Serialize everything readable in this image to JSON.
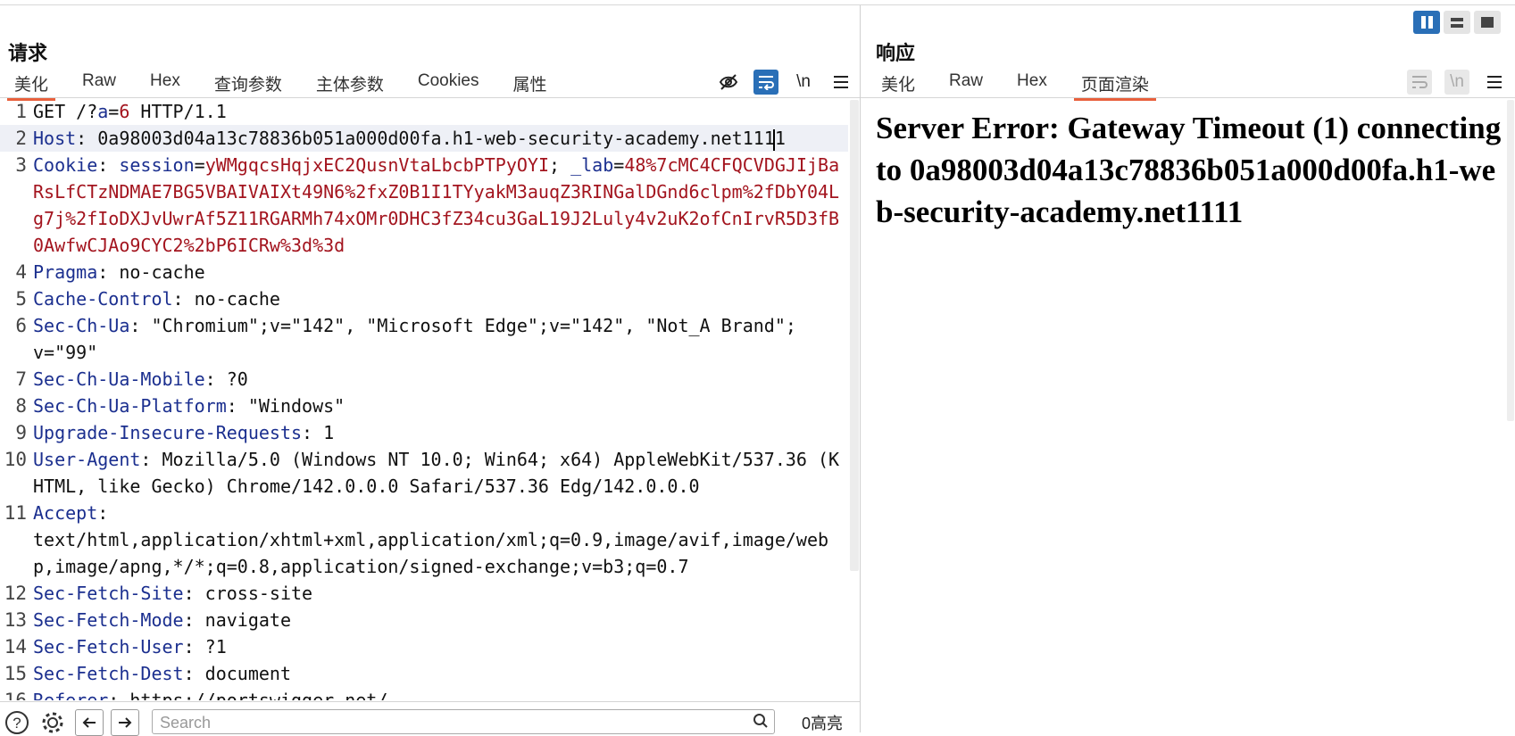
{
  "request": {
    "title": "请求",
    "tabs": [
      "美化",
      "Raw",
      "Hex",
      "查询参数",
      "主体参数",
      "Cookies",
      "属性"
    ],
    "active_tab": "美化",
    "toolbar": {
      "hide_icon": "eye-slash-icon",
      "wrap_icon": "wrap-icon",
      "newline_label": "\\n",
      "menu_icon": "menu-icon"
    },
    "lines": {
      "l1": {
        "num": "1",
        "a": "GET /?",
        "b": "a",
        "c": "=",
        "d": "6",
        "e": " HTTP/1.1"
      },
      "l2": {
        "num": "2",
        "k": "Host",
        "v": ": 0a98003d04a13c78836b051a000d00fa.h1-web-security-academy.net111",
        "tail": "1"
      },
      "l3": {
        "num": "3",
        "k": "Cookie",
        "sep": ": ",
        "k2": "session",
        "eq": "=",
        "v": "yWMgqcsHqjxEC2QusnVtaLbcbPTPyOYI",
        "semi": "; ",
        "k3": "_lab",
        "eq2": "=",
        "v2": "48%7cMC4CFQCVDGJIjBaRsLfCTzNDMAE7BG5VBAIVAIXt49N6%2fxZ0B1I1TYyakM3auqZ3RINGalDGnd6clpm%2fDbY04Lg7j%2fIoDXJvUwrAf5Z11RGARMh74xOMr0DHC3fZ34cu3GaL19J2Luly4v2uK2ofCnIrvR5D3fB0AwfwCJAo9CYC2%2bP6ICRw%3d%3d"
      },
      "l4": {
        "num": "4",
        "k": "Pragma",
        "v": ": no-cache"
      },
      "l5": {
        "num": "5",
        "k": "Cache-Control",
        "v": ": no-cache"
      },
      "l6": {
        "num": "6",
        "k": "Sec-Ch-Ua",
        "v": ": \"Chromium\";v=\"142\", \"Microsoft Edge\";v=\"142\", \"Not_A Brand\";v=\"99\""
      },
      "l7": {
        "num": "7",
        "k": "Sec-Ch-Ua-Mobile",
        "v": ": ?0"
      },
      "l8": {
        "num": "8",
        "k": "Sec-Ch-Ua-Platform",
        "v": ": \"Windows\""
      },
      "l9": {
        "num": "9",
        "k": "Upgrade-Insecure-Requests",
        "v": ": 1"
      },
      "l10": {
        "num": "10",
        "k": "User-Agent",
        "v": ": Mozilla/5.0 (Windows NT 10.0; Win64; x64) AppleWebKit/537.36 (KHTML, like Gecko) Chrome/142.0.0.0 Safari/537.36 Edg/142.0.0.0"
      },
      "l11": {
        "num": "11",
        "k": "Accept",
        "v": ":\ntext/html,application/xhtml+xml,application/xml;q=0.9,image/avif,image/webp,image/apng,*/*;q=0.8,application/signed-exchange;v=b3;q=0.7"
      },
      "l12": {
        "num": "12",
        "k": "Sec-Fetch-Site",
        "v": ": cross-site"
      },
      "l13": {
        "num": "13",
        "k": "Sec-Fetch-Mode",
        "v": ": navigate"
      },
      "l14": {
        "num": "14",
        "k": "Sec-Fetch-User",
        "v": ": ?1"
      },
      "l15": {
        "num": "15",
        "k": "Sec-Fetch-Dest",
        "v": ": document"
      },
      "l16": {
        "num": "16",
        "k": "Referer",
        "v": ": https://portswigger.net/"
      }
    },
    "bottom": {
      "search_placeholder": "Search",
      "highlight_count": "0高亮"
    }
  },
  "response": {
    "title": "响应",
    "tabs": [
      "美化",
      "Raw",
      "Hex",
      "页面渲染"
    ],
    "active_tab": "页面渲染",
    "body_text": "Server Error: Gateway Timeout (1) connecting to 0a98003d04a13c78836b051a000d00fa.h1-web-security-academy.net1111"
  },
  "colors": {
    "accent": "#e8603c",
    "blue": "#2a6fb7",
    "header_key": "#1b2f8f",
    "value_red": "#a3141e"
  }
}
